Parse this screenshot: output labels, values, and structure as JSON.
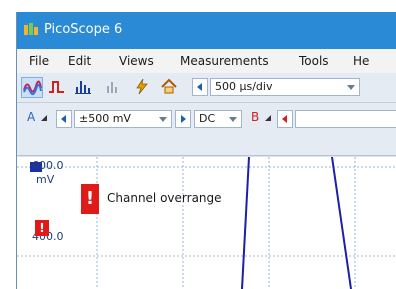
{
  "app": {
    "title": "PicoScope 6"
  },
  "menu": [
    {
      "label": "File"
    },
    {
      "label": "Edit"
    },
    {
      "label": "Views"
    },
    {
      "label": "Measurements"
    },
    {
      "label": "Tools"
    },
    {
      "label": "He"
    }
  ],
  "toolbar": {
    "timebase_value": "500 µs/div"
  },
  "channel_a": {
    "name": "A",
    "range_value": "±500 mV",
    "coupling_value": "DC"
  },
  "channel_b": {
    "name": "B"
  },
  "scope": {
    "y_ticks": [
      "600.0",
      "mV",
      "400.0"
    ],
    "overrange_icon": "!",
    "overrange_text": "Channel overrange",
    "small_warning_icon": "!"
  },
  "colors": {
    "titlebar": "#2a8ad6",
    "trace": "#1e1ea8",
    "warning": "#e01919"
  }
}
